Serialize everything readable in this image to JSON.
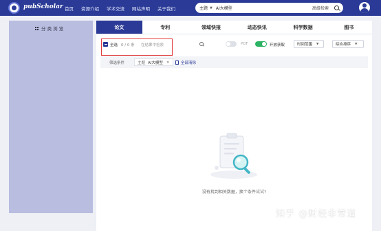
{
  "header": {
    "logo_text": "pubScholar",
    "nav": [
      "首页",
      "资源介绍",
      "学术交流",
      "网站声明",
      "关于我们"
    ],
    "search": {
      "field": "主题",
      "value": "AI大模型",
      "advanced": "高级检索"
    }
  },
  "sidebar": {
    "title": "分 类 浏 览"
  },
  "tabs": [
    "论文",
    "专利",
    "领域快报",
    "动态快讯",
    "科学数据",
    "图书"
  ],
  "active_tab": "论文",
  "toolbar": {
    "select_all": "全选",
    "count": "0 / 0 条",
    "inner_search_placeholder": "在结果中检索",
    "pdf_label": "PDF",
    "pdf_enabled": false,
    "open_label": "开放获取",
    "open_enabled": true,
    "time_range": "时间范围",
    "sort": "综合排序"
  },
  "filter": {
    "label": "筛选条件",
    "chip_field": "主题",
    "chip_value": "AI大模型",
    "chip_close": "×",
    "clear_all": "全部清除"
  },
  "empty_message": "没有找到相关数据，换个条件试试?",
  "watermark": "知乎 @财经非常道",
  "colors": {
    "brand": "#2a3a96",
    "sidebar": "#b9bde0",
    "toggle_on": "#2cb464",
    "highlight": "#e23b3b"
  }
}
